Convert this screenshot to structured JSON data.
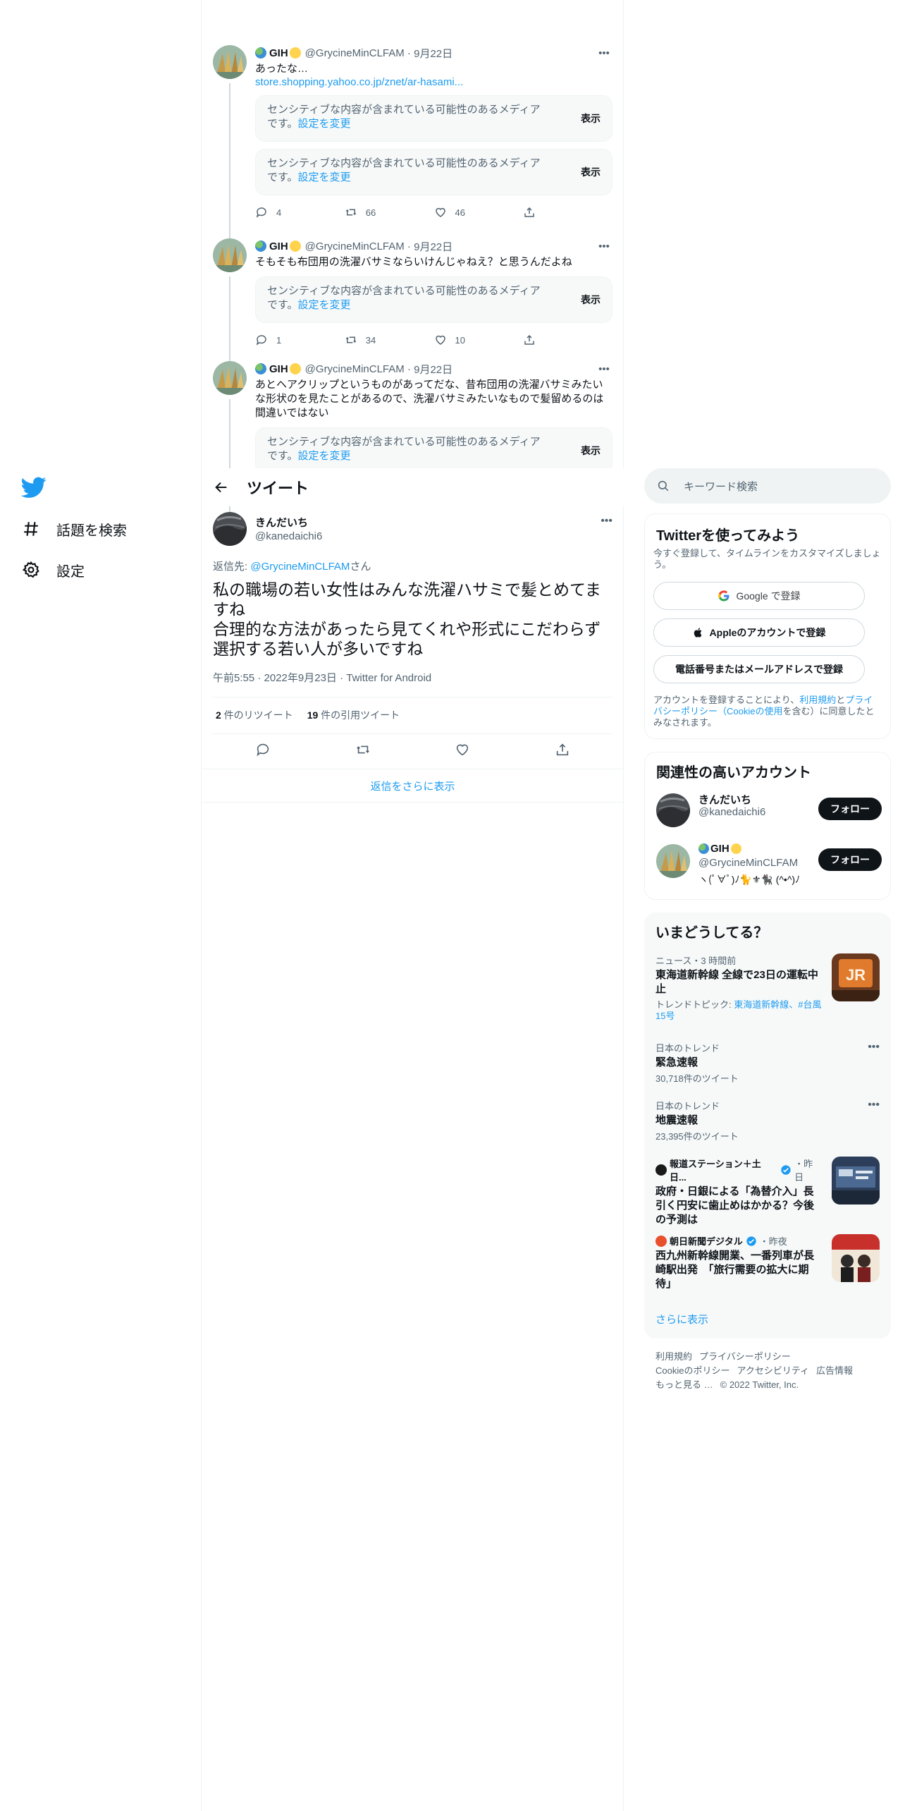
{
  "nav": {
    "items": [
      {
        "label": "話題を検索",
        "icon": "hashtag-icon"
      },
      {
        "label": "設定",
        "icon": "gear-icon"
      }
    ]
  },
  "context_tweets": [
    {
      "name": "GIH",
      "handle": "@GrycineMinCLFAM",
      "date": "9月22日",
      "text": "あったな…",
      "link": "store.shopping.yahoo.co.jp/znet/ar-hasami...",
      "sensitive": [
        {
          "text": "センシティブな内容が含まれている可能性のあるメディアです。",
          "change": "設定を変更",
          "show": "表示"
        },
        {
          "text": "センシティブな内容が含まれている可能性のあるメディアです。",
          "change": "設定を変更",
          "show": "表示"
        }
      ],
      "replies": "4",
      "retweets": "66",
      "likes": "46"
    },
    {
      "name": "GIH",
      "handle": "@GrycineMinCLFAM",
      "date": "9月22日",
      "text": "そもそも布団用の洗濯バサミならいけんじゃねえ？と思うんだよね",
      "sensitive": [
        {
          "text": "センシティブな内容が含まれている可能性のあるメディアです。",
          "change": "設定を変更",
          "show": "表示"
        }
      ],
      "replies": "1",
      "retweets": "34",
      "likes": "10"
    },
    {
      "name": "GIH",
      "handle": "@GrycineMinCLFAM",
      "date": "9月22日",
      "text": "あとヘアクリップというものがあってだな、昔布団用の洗濯バサミみたいな形状のを見たことがあるので、洗濯バサミみたいなもので髪留めるのは間違いではない",
      "sensitive": [
        {
          "text": "センシティブな内容が含まれている可能性のあるメディアです。",
          "change": "設定を変更",
          "show": "表示"
        }
      ]
    }
  ],
  "header": {
    "title": "ツイート"
  },
  "focal": {
    "name": "きんだいち",
    "handle": "@kanedaichi6",
    "reply_prefix": "返信先: ",
    "reply_to": "@GrycineMinCLFAM",
    "reply_suffix": "さん",
    "text": "私の職場の若い女性はみんな洗濯ハサミで髪とめてますね\n合理的な方法があったら見てくれや形式にこだわらず選択する若い人が多いですね",
    "meta": "午前5:55 · 2022年9月23日 · Twitter for Android",
    "retweet_count": "2",
    "retweet_label": "件のリツイート",
    "quote_count": "19",
    "quote_label": "件の引用ツイート"
  },
  "more_replies": "返信をさらに表示",
  "search": {
    "placeholder": "キーワード検索"
  },
  "signup": {
    "title": "Twitterを使ってみよう",
    "subtitle": "今すぐ登録して、タイムラインをカスタマイズしましょう。",
    "google": "Google で登録",
    "apple": "Appleのアカウントで登録",
    "phone": "電話番号またはメールアドレスで登録",
    "legal_1": "アカウントを登録することにより、",
    "legal_terms": "利用規約",
    "legal_2": "と",
    "legal_privacy": "プライバシーポリシー",
    "legal_3": "（",
    "legal_cookie": "Cookieの使用",
    "legal_4": "を含む）に同意したとみなされます。"
  },
  "related": {
    "title": "関連性の高いアカウント",
    "accounts": [
      {
        "name": "きんだいち",
        "handle": "@kanedaichi6",
        "follow": "フォロー"
      },
      {
        "name": "GIH",
        "handle": "@GrycineMinCLFAM",
        "bio": "ヽ(ﾟ∀ﾟ)ﾉ🐈⚜🐈‍⬛ (^•^)ﾉ",
        "follow": "フォロー"
      }
    ]
  },
  "trends": {
    "title": "いまどうしてる？",
    "items": [
      {
        "context": "ニュース・3 時間前",
        "title": "東海道新幹線 全線で23日の運転中止",
        "topic_label": "トレンドトピック: ",
        "topic_links": "東海道新幹線、#台風15号"
      },
      {
        "context": "日本のトレンド",
        "title": "緊急速報",
        "count": "30,718件のツイート"
      },
      {
        "context": "日本のトレンド",
        "title": "地震速報",
        "count": "23,395件のツイート"
      },
      {
        "source": "報道ステーション＋土日...",
        "time": "・昨日",
        "title": "政府・日銀による「為替介入」長引く円安に歯止めはかかる？今後の予測は"
      },
      {
        "source": "朝日新聞デジタル",
        "time": "・昨夜",
        "title": "西九州新幹線開業、一番列車が長崎駅出発　「旅行需要の拡大に期待」"
      }
    ],
    "show_more": "さらに表示"
  },
  "footer": {
    "links": [
      "利用規約",
      "プライバシーポリシー",
      "Cookieのポリシー",
      "アクセシビリティ",
      "広告情報",
      "もっと見る …"
    ],
    "copyright": "© 2022 Twitter, Inc."
  },
  "colors": {
    "accent": "#1d9bf0",
    "text": "#0f1419",
    "muted": "#536471",
    "border": "#eff3f4"
  }
}
